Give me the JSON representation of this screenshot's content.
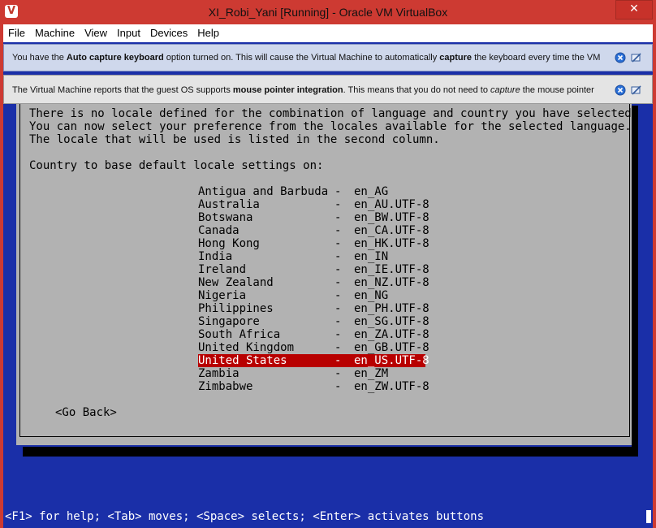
{
  "window": {
    "title": "XI_Robi_Yani [Running] - Oracle VM VirtualBox",
    "app_icon": "virtualbox-icon",
    "close_label": "✕"
  },
  "menu": [
    "File",
    "Machine",
    "View",
    "Input",
    "Devices",
    "Help"
  ],
  "notices": [
    {
      "text_pre": "You have the ",
      "bold1": "Auto capture keyboard",
      "text_mid": " option turned on. This will cause the Virtual Machine to automatically ",
      "bold2": "capture",
      "text_post": " the keyboard every time the VM"
    },
    {
      "text_pre": "The Virtual Machine reports that the guest OS supports ",
      "bold1": "mouse pointer integration",
      "text_mid": ". This means that you do not need to ",
      "italic": "capture",
      "text_post": " the mouse pointer"
    }
  ],
  "installer": {
    "description": "There is no locale defined for the combination of language and country you have selected.\nYou can now select your preference from the locales available for the selected language.\nThe locale that will be used is listed in the second column.",
    "prompt": "Country to base default locale settings on:",
    "separator": "-",
    "items": [
      {
        "country": "Antigua and Barbuda",
        "locale": "en_AG"
      },
      {
        "country": "Australia",
        "locale": "en_AU.UTF-8"
      },
      {
        "country": "Botswana",
        "locale": "en_BW.UTF-8"
      },
      {
        "country": "Canada",
        "locale": "en_CA.UTF-8"
      },
      {
        "country": "Hong Kong",
        "locale": "en_HK.UTF-8"
      },
      {
        "country": "India",
        "locale": "en_IN"
      },
      {
        "country": "Ireland",
        "locale": "en_IE.UTF-8"
      },
      {
        "country": "New Zealand",
        "locale": "en_NZ.UTF-8"
      },
      {
        "country": "Nigeria",
        "locale": "en_NG"
      },
      {
        "country": "Philippines",
        "locale": "en_PH.UTF-8"
      },
      {
        "country": "Singapore",
        "locale": "en_SG.UTF-8"
      },
      {
        "country": "South Africa",
        "locale": "en_ZA.UTF-8"
      },
      {
        "country": "United Kingdom",
        "locale": "en_GB.UTF-8"
      },
      {
        "country": "United States",
        "locale": "en_US.UTF-8"
      },
      {
        "country": "Zambia",
        "locale": "en_ZM"
      },
      {
        "country": "Zimbabwe",
        "locale": "en_ZW.UTF-8"
      }
    ],
    "selected_country": "United States",
    "go_back": "<Go Back>",
    "footer": "<F1> for help; <Tab> moves; <Space> selects; <Enter> activates buttons"
  },
  "colors": {
    "title_bar": "#cd3a32",
    "vm_background": "#1a2fa8",
    "dialog": "#b2b2b2",
    "selection": "#b80000"
  }
}
